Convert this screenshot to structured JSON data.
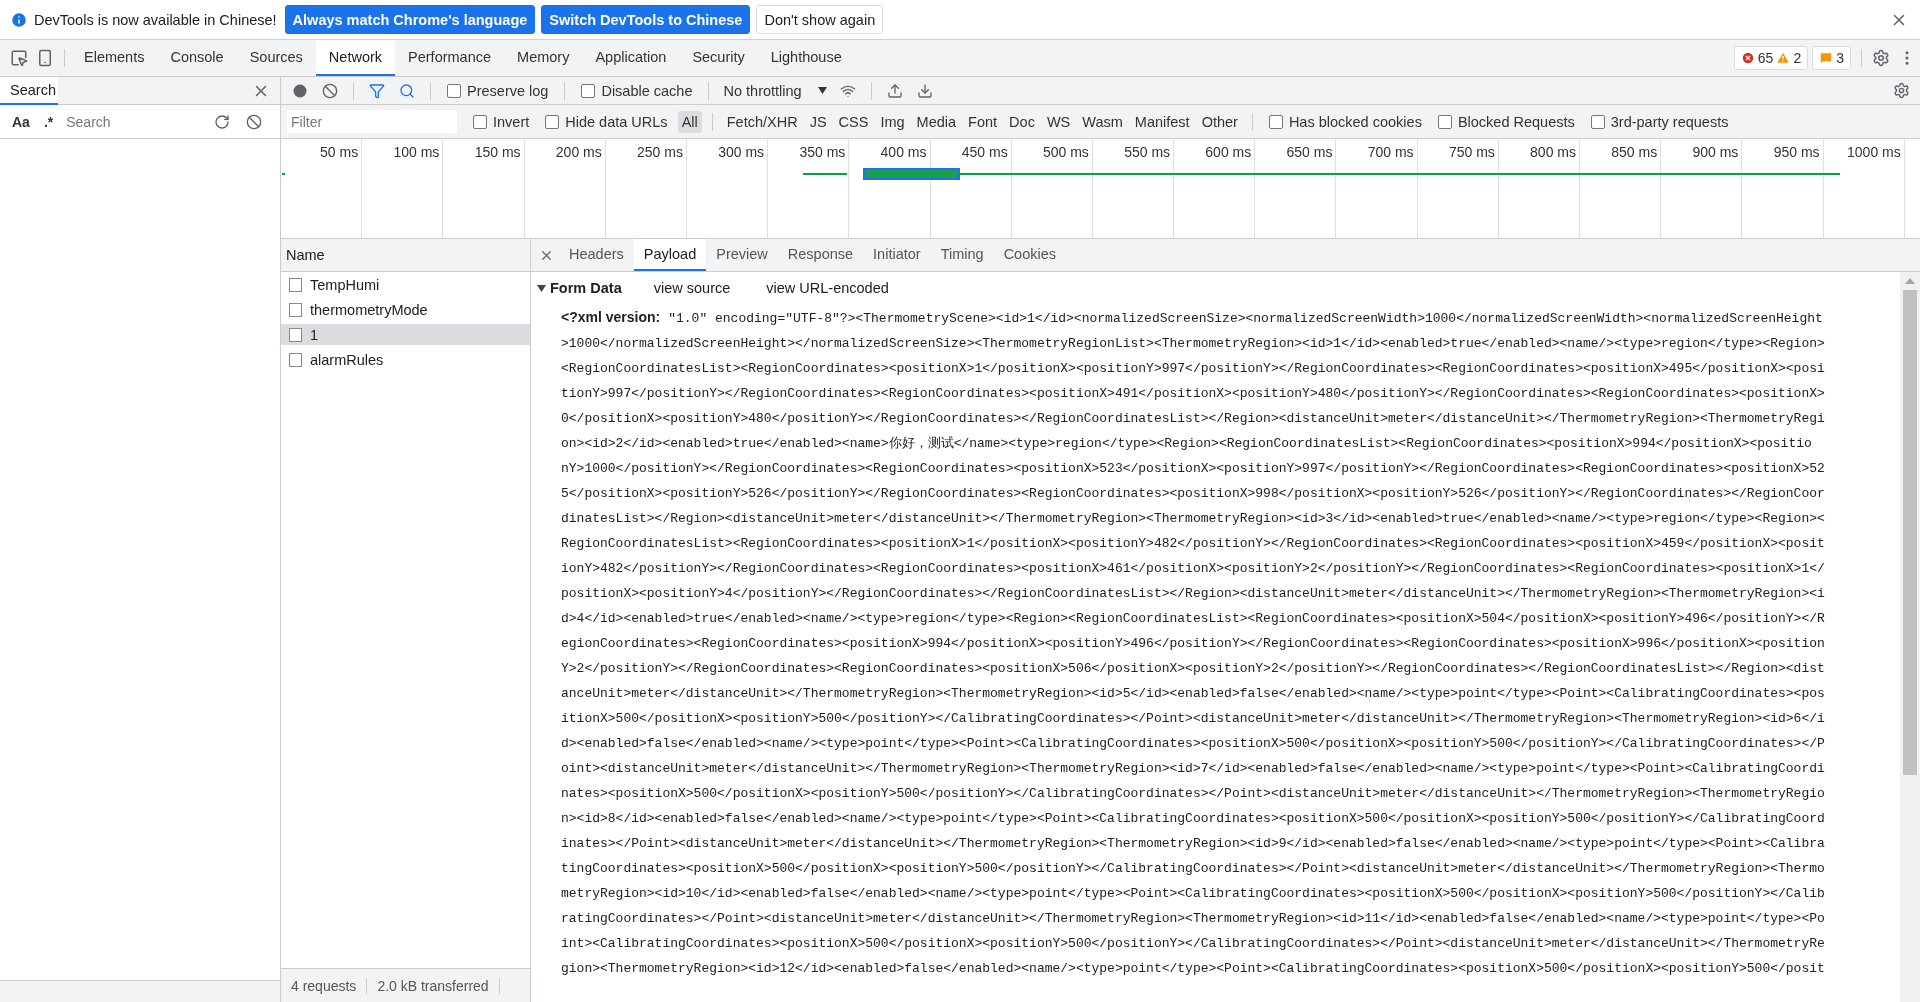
{
  "infobar": {
    "message": "DevTools is now available in Chinese!",
    "buttons": [
      {
        "label": "Always match Chrome's language",
        "kind": "primary"
      },
      {
        "label": "Switch DevTools to Chinese",
        "kind": "primary"
      },
      {
        "label": "Don't show again",
        "kind": "plain"
      }
    ]
  },
  "main_tabs": [
    {
      "label": "Elements",
      "selected": false
    },
    {
      "label": "Console",
      "selected": false
    },
    {
      "label": "Sources",
      "selected": false
    },
    {
      "label": "Network",
      "selected": true
    },
    {
      "label": "Performance",
      "selected": false
    },
    {
      "label": "Memory",
      "selected": false
    },
    {
      "label": "Application",
      "selected": false
    },
    {
      "label": "Security",
      "selected": false
    },
    {
      "label": "Lighthouse",
      "selected": false
    }
  ],
  "console_counters": [
    {
      "kind": "error",
      "count": "65"
    },
    {
      "kind": "warning",
      "count": "2"
    }
  ],
  "issue_counters": [
    {
      "kind": "info",
      "count": "3"
    }
  ],
  "drawer": {
    "tab": "Search",
    "case_toggle": "Aa",
    "regex_toggle": ".*",
    "placeholder": "Search"
  },
  "toolbar": {
    "filter_active": true,
    "options": [
      {
        "label": "Preserve log",
        "checked": false
      },
      {
        "label": "Disable cache",
        "checked": false
      }
    ],
    "throttling": "No throttling"
  },
  "filter_bar": {
    "placeholder": "Filter",
    "options": [
      {
        "label": "Invert",
        "checked": false
      },
      {
        "label": "Hide data URLs",
        "checked": false
      }
    ],
    "types": [
      {
        "label": "All",
        "selected": true
      },
      {
        "label": "Fetch/XHR",
        "selected": false
      },
      {
        "label": "JS",
        "selected": false
      },
      {
        "label": "CSS",
        "selected": false
      },
      {
        "label": "Img",
        "selected": false
      },
      {
        "label": "Media",
        "selected": false
      },
      {
        "label": "Font",
        "selected": false
      },
      {
        "label": "Doc",
        "selected": false
      },
      {
        "label": "WS",
        "selected": false
      },
      {
        "label": "Wasm",
        "selected": false
      },
      {
        "label": "Manifest",
        "selected": false
      },
      {
        "label": "Other",
        "selected": false
      }
    ],
    "extra_options": [
      {
        "label": "Has blocked cookies",
        "checked": false
      },
      {
        "label": "Blocked Requests",
        "checked": false
      },
      {
        "label": "3rd-party requests",
        "checked": false
      }
    ]
  },
  "overview": {
    "ticks": [
      "50 ms",
      "100 ms",
      "150 ms",
      "200 ms",
      "250 ms",
      "300 ms",
      "350 ms",
      "400 ms",
      "450 ms",
      "500 ms",
      "550 ms",
      "600 ms",
      "650 ms",
      "700 ms",
      "750 ms",
      "800 ms",
      "850 ms",
      "900 ms",
      "950 ms",
      "1000 ms"
    ]
  },
  "requests": {
    "column": "Name",
    "rows": [
      {
        "name": "TempHumi",
        "selected": false
      },
      {
        "name": "thermometryMode",
        "selected": false
      },
      {
        "name": "1",
        "selected": true
      },
      {
        "name": "alarmRules",
        "selected": false
      }
    ]
  },
  "status_bar": [
    "4 requests",
    "2.0 kB transferred"
  ],
  "detail_tabs": [
    {
      "label": "Headers",
      "selected": false
    },
    {
      "label": "Payload",
      "selected": true
    },
    {
      "label": "Preview",
      "selected": false
    },
    {
      "label": "Response",
      "selected": false
    },
    {
      "label": "Initiator",
      "selected": false
    },
    {
      "label": "Timing",
      "selected": false
    },
    {
      "label": "Cookies",
      "selected": false
    }
  ],
  "payload": {
    "section": "Form Data",
    "expanded": true,
    "links": [
      "view source",
      "view URL-encoded"
    ],
    "key": "<?xml version:",
    "lines": [
      "\"1.0\" encoding=\"UTF-8\"?><ThermometryScene><id>1</id><normalizedScreenSize><normalizedScreenWidth>1000</normalizedScreenWidth><normalizedScreenHeight",
      ">1000</normalizedScreenHeight></normalizedScreenSize><ThermometryRegionList><ThermometryRegion><id>1</id><enabled>true</enabled><name/><type>region</type><Region>",
      "<RegionCoordinatesList><RegionCoordinates><positionX>1</positionX><positionY>997</positionY></RegionCoordinates><RegionCoordinates><positionX>495</positionX><posi",
      "tionY>997</positionY></RegionCoordinates><RegionCoordinates><positionX>491</positionX><positionY>480</positionY></RegionCoordinates><RegionCoordinates><positionX>",
      "0</positionX><positionY>480</positionY></RegionCoordinates></RegionCoordinatesList></Region><distanceUnit>meter</distanceUnit></ThermometryRegion><ThermometryRegi",
      "on><id>2</id><enabled>true</enabled><name>你好，测试</name><type>region</type><Region><RegionCoordinatesList><RegionCoordinates><positionX>994</positionX><positio",
      "nY>1000</positionY></RegionCoordinates><RegionCoordinates><positionX>523</positionX><positionY>997</positionY></RegionCoordinates><RegionCoordinates><positionX>52",
      "5</positionX><positionY>526</positionY></RegionCoordinates><RegionCoordinates><positionX>998</positionX><positionY>526</positionY></RegionCoordinates></RegionCoor",
      "dinatesList></Region><distanceUnit>meter</distanceUnit></ThermometryRegion><ThermometryRegion><id>3</id><enabled>true</enabled><name/><type>region</type><Region><",
      "RegionCoordinatesList><RegionCoordinates><positionX>1</positionX><positionY>482</positionY></RegionCoordinates><RegionCoordinates><positionX>459</positionX><posit",
      "ionY>482</positionY></RegionCoordinates><RegionCoordinates><positionX>461</positionX><positionY>2</positionY></RegionCoordinates><RegionCoordinates><positionX>1</",
      "positionX><positionY>4</positionY></RegionCoordinates></RegionCoordinatesList></Region><distanceUnit>meter</distanceUnit></ThermometryRegion><ThermometryRegion><i",
      "d>4</id><enabled>true</enabled><name/><type>region</type><Region><RegionCoordinatesList><RegionCoordinates><positionX>504</positionX><positionY>496</positionY></R",
      "egionCoordinates><RegionCoordinates><positionX>994</positionX><positionY>496</positionY></RegionCoordinates><RegionCoordinates><positionX>996</positionX><position",
      "Y>2</positionY></RegionCoordinates><RegionCoordinates><positionX>506</positionX><positionY>2</positionY></RegionCoordinates></RegionCoordinatesList></Region><dist",
      "anceUnit>meter</distanceUnit></ThermometryRegion><ThermometryRegion><id>5</id><enabled>false</enabled><name/><type>point</type><Point><CalibratingCoordinates><pos",
      "itionX>500</positionX><positionY>500</positionY></CalibratingCoordinates></Point><distanceUnit>meter</distanceUnit></ThermometryRegion><ThermometryRegion><id>6</i",
      "d><enabled>false</enabled><name/><type>point</type><Point><CalibratingCoordinates><positionX>500</positionX><positionY>500</positionY></CalibratingCoordinates></P",
      "oint><distanceUnit>meter</distanceUnit></ThermometryRegion><ThermometryRegion><id>7</id><enabled>false</enabled><name/><type>point</type><Point><CalibratingCoordi",
      "nates><positionX>500</positionX><positionY>500</positionY></CalibratingCoordinates></Point><distanceUnit>meter</distanceUnit></ThermometryRegion><ThermometryRegio",
      "n><id>8</id><enabled>false</enabled><name/><type>point</type><Point><CalibratingCoordinates><positionX>500</positionX><positionY>500</positionY></CalibratingCoord",
      "inates></Point><distanceUnit>meter</distanceUnit></ThermometryRegion><ThermometryRegion><id>9</id><enabled>false</enabled><name/><type>point</type><Point><Calibra",
      "tingCoordinates><positionX>500</positionX><positionY>500</positionY></CalibratingCoordinates></Point><distanceUnit>meter</distanceUnit></ThermometryRegion><Thermo",
      "metryRegion><id>10</id><enabled>false</enabled><name/><type>point</type><Point><CalibratingCoordinates><positionX>500</positionX><positionY>500</positionY></Calib",
      "ratingCoordinates></Point><distanceUnit>meter</distanceUnit></ThermometryRegion><ThermometryRegion><id>11</id><enabled>false</enabled><name/><type>point</type><Po",
      "int><CalibratingCoordinates><positionX>500</positionX><positionY>500</positionY></CalibratingCoordinates></Point><distanceUnit>meter</distanceUnit></ThermometryRe",
      "gion><ThermometryRegion><id>12</id><enabled>false</enabled><name/><type>point</type><Point><CalibratingCoordinates><positionX>500</positionX><positionY>500</posit"
    ]
  }
}
